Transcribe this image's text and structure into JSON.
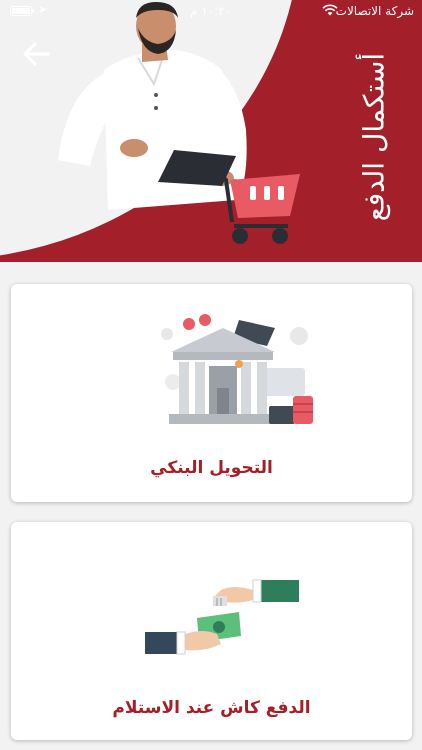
{
  "status_bar": {
    "carrier": "شركة الاتصالات",
    "time": "١٠:٢٠ م"
  },
  "header": {
    "title": "أستكمال الدفع",
    "accent_color": "#a3202a",
    "back_icon": "arrow-left-icon"
  },
  "payment_options": [
    {
      "label": "التحويل البنكي",
      "icon": "bank-icon"
    },
    {
      "label": "الدفع كاش عند الاستلام",
      "icon": "cash-handover-icon"
    }
  ]
}
